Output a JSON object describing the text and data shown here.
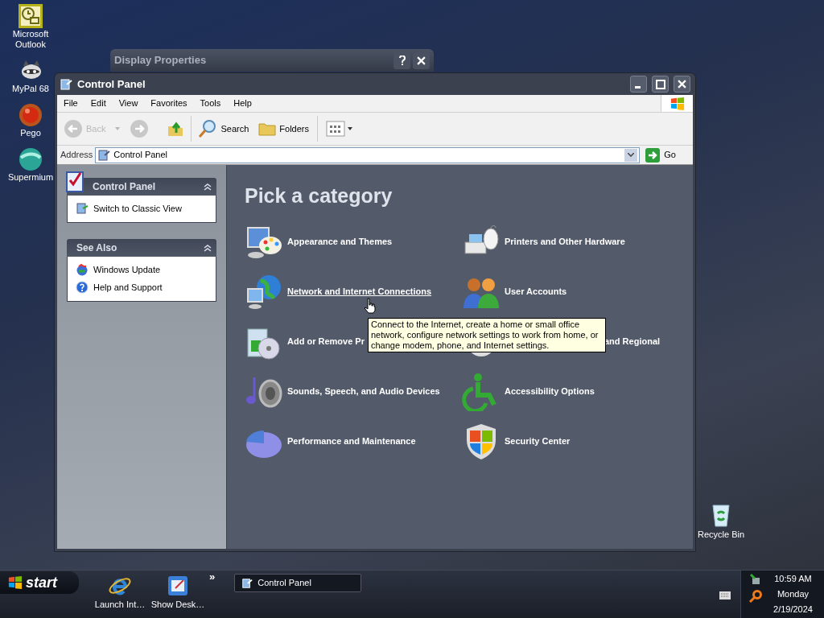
{
  "desktop_icons": [
    {
      "label": "Microsoft Outlook"
    },
    {
      "label": "MyPal 68"
    },
    {
      "label": "Pego"
    },
    {
      "label": "Supermium"
    }
  ],
  "background_window": {
    "title": "Display Properties"
  },
  "window": {
    "title": "Control Panel",
    "menu": [
      "File",
      "Edit",
      "View",
      "Favorites",
      "Tools",
      "Help"
    ],
    "toolbar": {
      "back": {
        "label": "Back",
        "disabled": true
      },
      "forward": {
        "disabled": true
      },
      "search": "Search",
      "folders": "Folders"
    },
    "address": {
      "label": "Address",
      "value": "Control Panel",
      "go": "Go"
    },
    "sidebar": {
      "panels": [
        {
          "title": "Control Panel",
          "links": [
            "Switch to Classic View"
          ]
        },
        {
          "title": "See Also",
          "links": [
            "Windows Update",
            "Help and Support"
          ]
        }
      ]
    },
    "heading": "Pick a category",
    "categories": [
      {
        "label": "Appearance and Themes",
        "hovered": false
      },
      {
        "label": "Printers and Other Hardware",
        "hovered": false
      },
      {
        "label": "Network and Internet Connections",
        "hovered": true
      },
      {
        "label": "User Accounts",
        "hovered": false
      },
      {
        "label": "Add or Remove Pr",
        "hovered": false
      },
      {
        "label": "and Regional",
        "hovered": false
      },
      {
        "label": "Sounds, Speech, and Audio Devices",
        "hovered": false
      },
      {
        "label": "Accessibility Options",
        "hovered": false
      },
      {
        "label": "Performance and Maintenance",
        "hovered": false
      },
      {
        "label": "Security Center",
        "hovered": false
      }
    ],
    "tooltip": "Connect to the Internet, create a home or small office network, configure network settings to work from home, or change modem, phone, and Internet settings."
  },
  "recycle_bin": {
    "label": "Recycle Bin"
  },
  "taskbar": {
    "start": "start",
    "quick_launch": [
      {
        "label": "Launch Int…"
      },
      {
        "label": "Show Desk…"
      }
    ],
    "chevron": "»",
    "tasks": [
      {
        "label": "Control Panel",
        "selected": true
      }
    ],
    "clock": {
      "time": "10:59 AM",
      "day": "Monday",
      "date": "2/19/2024"
    }
  }
}
